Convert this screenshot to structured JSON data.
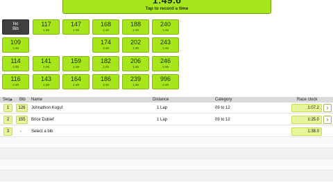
{
  "clock_button": {
    "time": "1:49.6",
    "label": "Tap to record a time"
  },
  "bib_tiles": [
    {
      "num": "No",
      "sub": "Bib"
    },
    {
      "num": "117",
      "sub": "1:49"
    },
    {
      "num": "147",
      "sub": "1:49"
    },
    {
      "num": "168",
      "sub": "1:49"
    },
    {
      "num": "188",
      "sub": "1:49"
    },
    {
      "num": "240",
      "sub": "1:49"
    },
    {
      "num": "109",
      "sub": "1:49"
    },
    {
      "num": "174",
      "sub": "1:49"
    },
    {
      "num": "202",
      "sub": "1:49"
    },
    {
      "num": "243",
      "sub": "1:49"
    },
    {
      "num": "114",
      "sub": "1:49"
    },
    {
      "num": "141",
      "sub": "1:49"
    },
    {
      "num": "159",
      "sub": "1:49"
    },
    {
      "num": "182",
      "sub": "1:49"
    },
    {
      "num": "206",
      "sub": "1:49"
    },
    {
      "num": "246",
      "sub": "1:49"
    },
    {
      "num": "116",
      "sub": "1:49"
    },
    {
      "num": "143",
      "sub": "1:49"
    },
    {
      "num": "164",
      "sub": "1:49"
    },
    {
      "num": "186",
      "sub": "1:49"
    },
    {
      "num": "239",
      "sub": "1:49"
    },
    {
      "num": "996",
      "sub": "1:49"
    }
  ],
  "table": {
    "headers": {
      "seq": "Seq▴",
      "bib": "Bib",
      "name": "Name",
      "distance": "Distance",
      "category": "Category",
      "race_clock": "Race clock"
    },
    "rows": [
      {
        "seq": "1",
        "bib": "126",
        "name": "Johnathon Kogut",
        "distance": "1 Lap",
        "category": "09 to 12",
        "time": "1:07.2"
      },
      {
        "seq": "2",
        "bib": "155",
        "name": "Brice Dubief",
        "distance": "1 Lap",
        "category": "09 to 12",
        "time": "1:25.0"
      },
      {
        "seq": "3",
        "bib": "-",
        "name": "Select a bib",
        "distance": "",
        "category": "",
        "time": "1:38.0"
      }
    ]
  },
  "icons": {
    "row_arrow": "chevron-right-icon"
  },
  "colors": {
    "accent_green": "#a8e61c",
    "no_bib_dark": "#3f3f3f",
    "time_cell": "#e8f59a"
  }
}
